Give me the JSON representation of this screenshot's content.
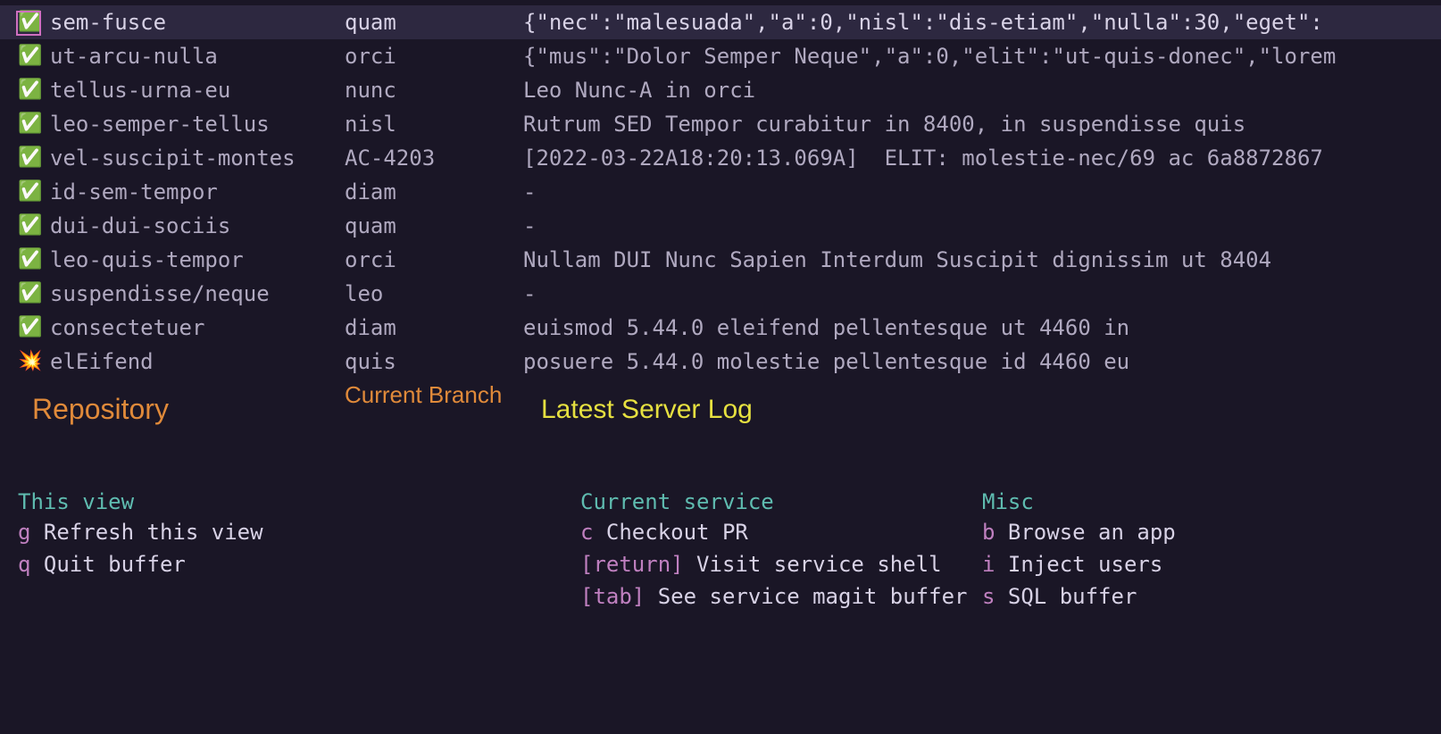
{
  "icons": {
    "check": "✅",
    "collision": "💥"
  },
  "rows": [
    {
      "icon": "check",
      "selected": true,
      "repo": "sem-fusce",
      "branch": "quam",
      "log": "{\"nec\":\"malesuada\",\"a\":0,\"nisl\":\"dis-etiam\",\"nulla\":30,\"eget\":"
    },
    {
      "icon": "check",
      "selected": false,
      "repo": "ut-arcu-nulla",
      "branch": "orci",
      "log": "{\"mus\":\"Dolor Semper Neque\",\"a\":0,\"elit\":\"ut-quis-donec\",\"lorem"
    },
    {
      "icon": "check",
      "selected": false,
      "repo": "tellus-urna-eu",
      "branch": "nunc",
      "log": "Leo Nunc-A in orci"
    },
    {
      "icon": "check",
      "selected": false,
      "repo": "leo-semper-tellus",
      "branch": "nisl",
      "log": "Rutrum SED Tempor curabitur in 8400, in suspendisse quis"
    },
    {
      "icon": "check",
      "selected": false,
      "repo": "vel-suscipit-montes",
      "branch": "AC-4203",
      "log": "[2022-03-22A18:20:13.069A]  ELIT: molestie-nec/69 ac 6a8872867"
    },
    {
      "icon": "check",
      "selected": false,
      "repo": "id-sem-tempor",
      "branch": "diam",
      "log": "-"
    },
    {
      "icon": "check",
      "selected": false,
      "repo": "dui-dui-sociis",
      "branch": "quam",
      "log": "-"
    },
    {
      "icon": "check",
      "selected": false,
      "repo": "leo-quis-tempor",
      "branch": "orci",
      "log": "Nullam DUI Nunc Sapien Interdum Suscipit dignissim ut 8404"
    },
    {
      "icon": "check",
      "selected": false,
      "repo": "suspendisse/neque",
      "branch": "leo",
      "log": "-"
    },
    {
      "icon": "check",
      "selected": false,
      "repo": "consectetuer",
      "branch": "diam",
      "log": "euismod 5.44.0 eleifend pellentesque ut 4460 in"
    },
    {
      "icon": "collision",
      "selected": false,
      "repo": "elEifend",
      "branch": "quis",
      "log": "posuere 5.44.0 molestie pellentesque id 4460 eu"
    }
  ],
  "headers": {
    "repo": "Repository",
    "branch": "Current\nBranch",
    "log": "Latest Server Log"
  },
  "help": {
    "col1": {
      "title": "This view",
      "items": [
        {
          "key": "g",
          "label": "Refresh this view"
        },
        {
          "key": "q",
          "label": "Quit buffer"
        }
      ]
    },
    "col2": {
      "title": "Current service",
      "items": [
        {
          "key": "c",
          "label": "Checkout PR"
        },
        {
          "key": "[return]",
          "label": "Visit service shell"
        },
        {
          "key": "[tab]",
          "label": "See service magit buffer"
        }
      ]
    },
    "col3": {
      "title": "Misc",
      "items": [
        {
          "key": "b",
          "label": "Browse an app"
        },
        {
          "key": "i",
          "label": "Inject users"
        },
        {
          "key": "s",
          "label": "SQL buffer"
        }
      ]
    }
  }
}
